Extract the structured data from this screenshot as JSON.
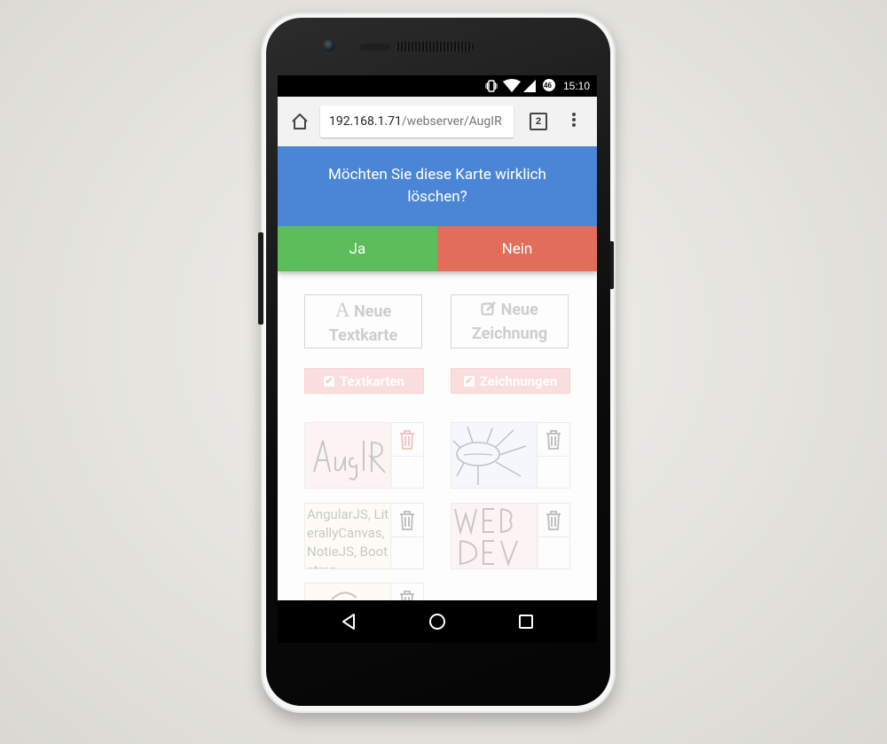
{
  "status_bar": {
    "time": "15:10",
    "battery": "46"
  },
  "browser": {
    "url_host": "192.168.1.71",
    "url_path": "/webserver/AugIR",
    "tab_count": "2"
  },
  "dialog": {
    "message": "Möchten Sie diese Karte wirklich löschen?",
    "yes_label": "Ja",
    "no_label": "Nein"
  },
  "actions": {
    "new_text_card": "Neue Textkarte",
    "new_drawing": "Neue Zeichnung"
  },
  "filters": {
    "text_cards": "Textkarten",
    "drawings": "Zeichnungen"
  },
  "cards": [
    {
      "type": "drawing",
      "bg": "#fde3e3",
      "icon": "trash-icon-red"
    },
    {
      "type": "drawing",
      "bg": "#e6f0fb",
      "icon": "trash-icon"
    },
    {
      "type": "text",
      "bg": "#fdfbe6",
      "text": "AngularJS, LiterallyCanvas, NotieJS, Bootstrap",
      "icon": "trash-icon"
    },
    {
      "type": "drawing",
      "bg": "#fde3e3",
      "icon": "trash-icon"
    },
    {
      "type": "drawing",
      "bg": "#fdfbe6",
      "icon": "trash-icon"
    }
  ],
  "colors": {
    "dialog": "#4b85d6",
    "yes": "#5cbd5a",
    "no": "#e26d5a"
  }
}
